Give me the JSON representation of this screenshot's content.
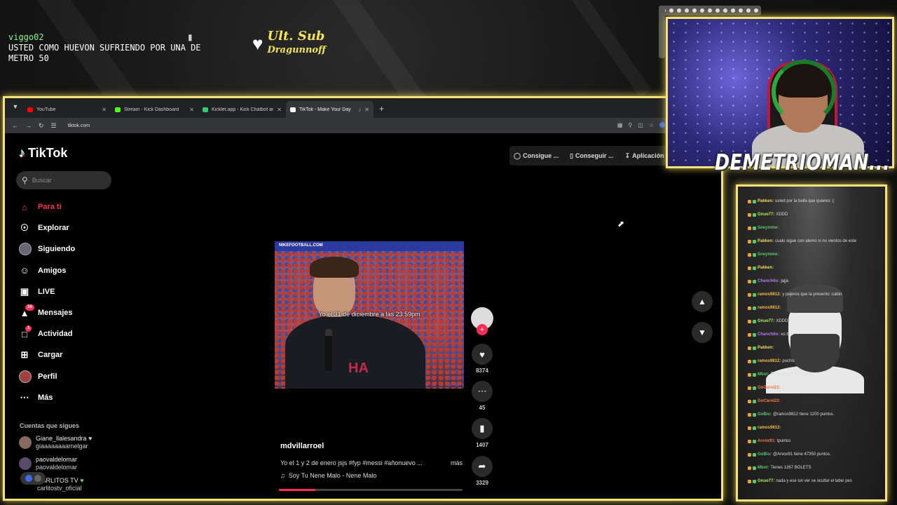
{
  "overlay": {
    "chat_user": "viggo02",
    "chat_message": "USTED COMO HUEVON SUFRIENDO POR UNA DE METRO 50",
    "ult_sub_label": "Ult. Sub",
    "ult_sub_name": "Dragunnoff",
    "streamer_name": "DEMETRIOMAN..."
  },
  "browser": {
    "tabs": [
      {
        "title": "YouTube",
        "color": "#ff0000"
      },
      {
        "title": "Stream - Kick Dashboard",
        "color": "#53fc18"
      },
      {
        "title": "Kicklet.app - Kick Chatbot and",
        "color": "#2ecc71"
      },
      {
        "title": "TikTok - Make Your Day",
        "color": "#ffffff"
      }
    ],
    "url": "tiktok.com"
  },
  "tiktok": {
    "logo": "TikTok",
    "search_placeholder": "Buscar",
    "nav": [
      {
        "label": "Para ti",
        "icon": "home-icon"
      },
      {
        "label": "Explorar",
        "icon": "compass-icon"
      },
      {
        "label": "Siguiendo",
        "icon": "following-avatar"
      },
      {
        "label": "Amigos",
        "icon": "friends-icon"
      },
      {
        "label": "LIVE",
        "icon": "live-tv-icon"
      },
      {
        "label": "Mensajes",
        "icon": "messages-icon",
        "badge": "16"
      },
      {
        "label": "Actividad",
        "icon": "activity-icon",
        "badge": "1"
      },
      {
        "label": "Cargar",
        "icon": "upload-icon"
      },
      {
        "label": "Perfil",
        "icon": "profile-avatar"
      },
      {
        "label": "Más",
        "icon": "more-icon"
      }
    ],
    "following_title": "Cuentas que sigues",
    "following": [
      {
        "name": "Giane_llalesandra",
        "handle": "giaaaaaaaamelgar"
      },
      {
        "name": "paovaldelomar",
        "handle": "paovaldelomar"
      },
      {
        "name": "CARLITOS TV",
        "handle": "carlitostv_oficial"
      }
    ],
    "top_buttons": [
      "Consigue ...",
      "Conseguir ...",
      "Aplicación"
    ],
    "video": {
      "banner": "NIKEFOOTBALL.COM",
      "caption": "Yo el 31 de diciembre a las 23:59pm",
      "chest_text": "HA",
      "author": "mdvillarroel",
      "description": "Yo el 1 y 2 de enero jsjs #fyp #messi #añonuevo ...",
      "more": "más",
      "song": "Soy Tu Nene Malo - Nene Malo",
      "likes": "8374",
      "comments": "45",
      "saves": "1407",
      "shares": "3329",
      "progress": 0.2
    }
  },
  "kick_chat": [
    {
      "name": "Pakken:",
      "text": "usted por la bella que quieres :(",
      "color": "#f5d75a"
    },
    {
      "name": "Gnuo77:",
      "text": "XDDD",
      "color": "#b0f05a"
    },
    {
      "name": "Sneymme:",
      "text": "",
      "color": "#59c76a"
    },
    {
      "name": "Pakken:",
      "text": "cualo sigue con alemo si no vientos de este",
      "color": "#f5d75a"
    },
    {
      "name": "Sneymme:",
      "text": "",
      "color": "#59c76a"
    },
    {
      "name": "Pakken:",
      "text": "",
      "color": "#f5d75a"
    },
    {
      "name": "Chanchito:",
      "text": "jajja",
      "color": "#b47ef0"
    },
    {
      "name": "ramos9812:",
      "text": "y pajeros que la presento :cabin",
      "color": "#f5b94a"
    },
    {
      "name": "ramos9812:",
      "text": "",
      "color": "#f5b94a"
    },
    {
      "name": "Gnuo77:",
      "text": "XDDD",
      "color": "#b0f05a"
    },
    {
      "name": "Chanchito:",
      "text": "es bilo",
      "color": "#b47ef0"
    },
    {
      "name": "Pakken:",
      "text": "",
      "color": "#f5d75a"
    },
    {
      "name": "ramos9812:",
      "text": "puchis",
      "color": "#f5b94a"
    },
    {
      "name": "Mbot:",
      "text": "Tienes 4247 TOKENS",
      "color": "#59c76a"
    },
    {
      "name": "GoCarol23:",
      "text": "",
      "color": "#f07a4a"
    },
    {
      "name": "GoCarol23:",
      "text": "",
      "color": "#f07a4a"
    },
    {
      "name": "GoBio:",
      "text": "@ramos9812 tiene 1200 puntos.",
      "color": "#59c76a"
    },
    {
      "name": "ramos9812:",
      "text": "",
      "color": "#f5b94a"
    },
    {
      "name": "Arvox91:",
      "text": "tpuntos",
      "color": "#f07a4a"
    },
    {
      "name": "GoBio:",
      "text": "@Arvox91 tiene 47350 puntos.",
      "color": "#59c76a"
    },
    {
      "name": "Mbot:",
      "text": "Tienes 1367 BOLETS",
      "color": "#59c76a"
    },
    {
      "name": "Gnuo77:",
      "text": "nada y ese sin ver se ocultar el labio pes",
      "color": "#b0f05a"
    }
  ]
}
